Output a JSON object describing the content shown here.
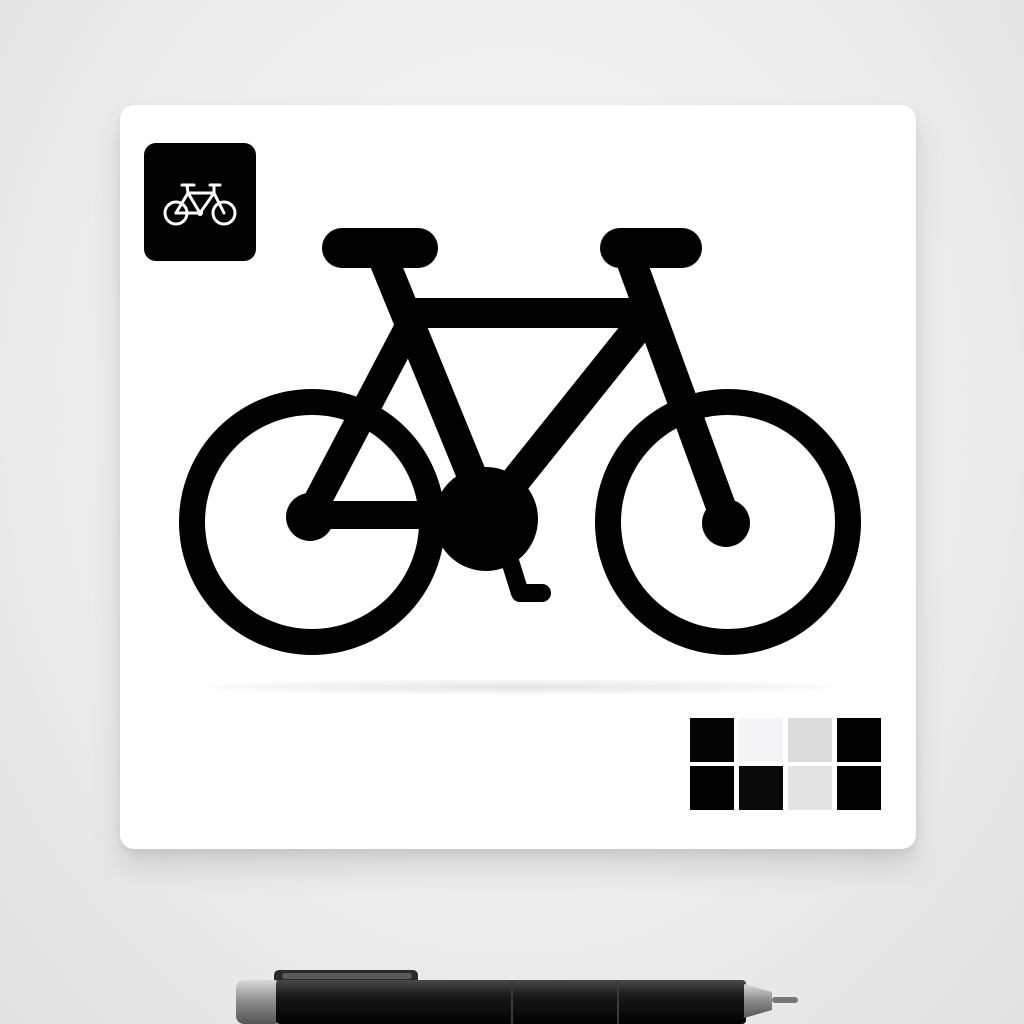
{
  "icons": {
    "app_icon": "bicycle-icon",
    "hero": "bicycle-icon"
  },
  "colors": {
    "background": "#ececec",
    "card": "#ffffff",
    "bike": "#000000",
    "app_icon_bg": "#000000",
    "app_icon_fg": "#ffffff"
  },
  "swatches": [
    {
      "color": "#050505"
    },
    {
      "color": "#f4f4f6"
    },
    {
      "color": "#dcdcdc"
    },
    {
      "color": "#000000"
    },
    {
      "color": "#000000"
    },
    {
      "color": "#0a0a0a"
    },
    {
      "color": "#e4e4e4"
    },
    {
      "color": "#000000"
    }
  ]
}
